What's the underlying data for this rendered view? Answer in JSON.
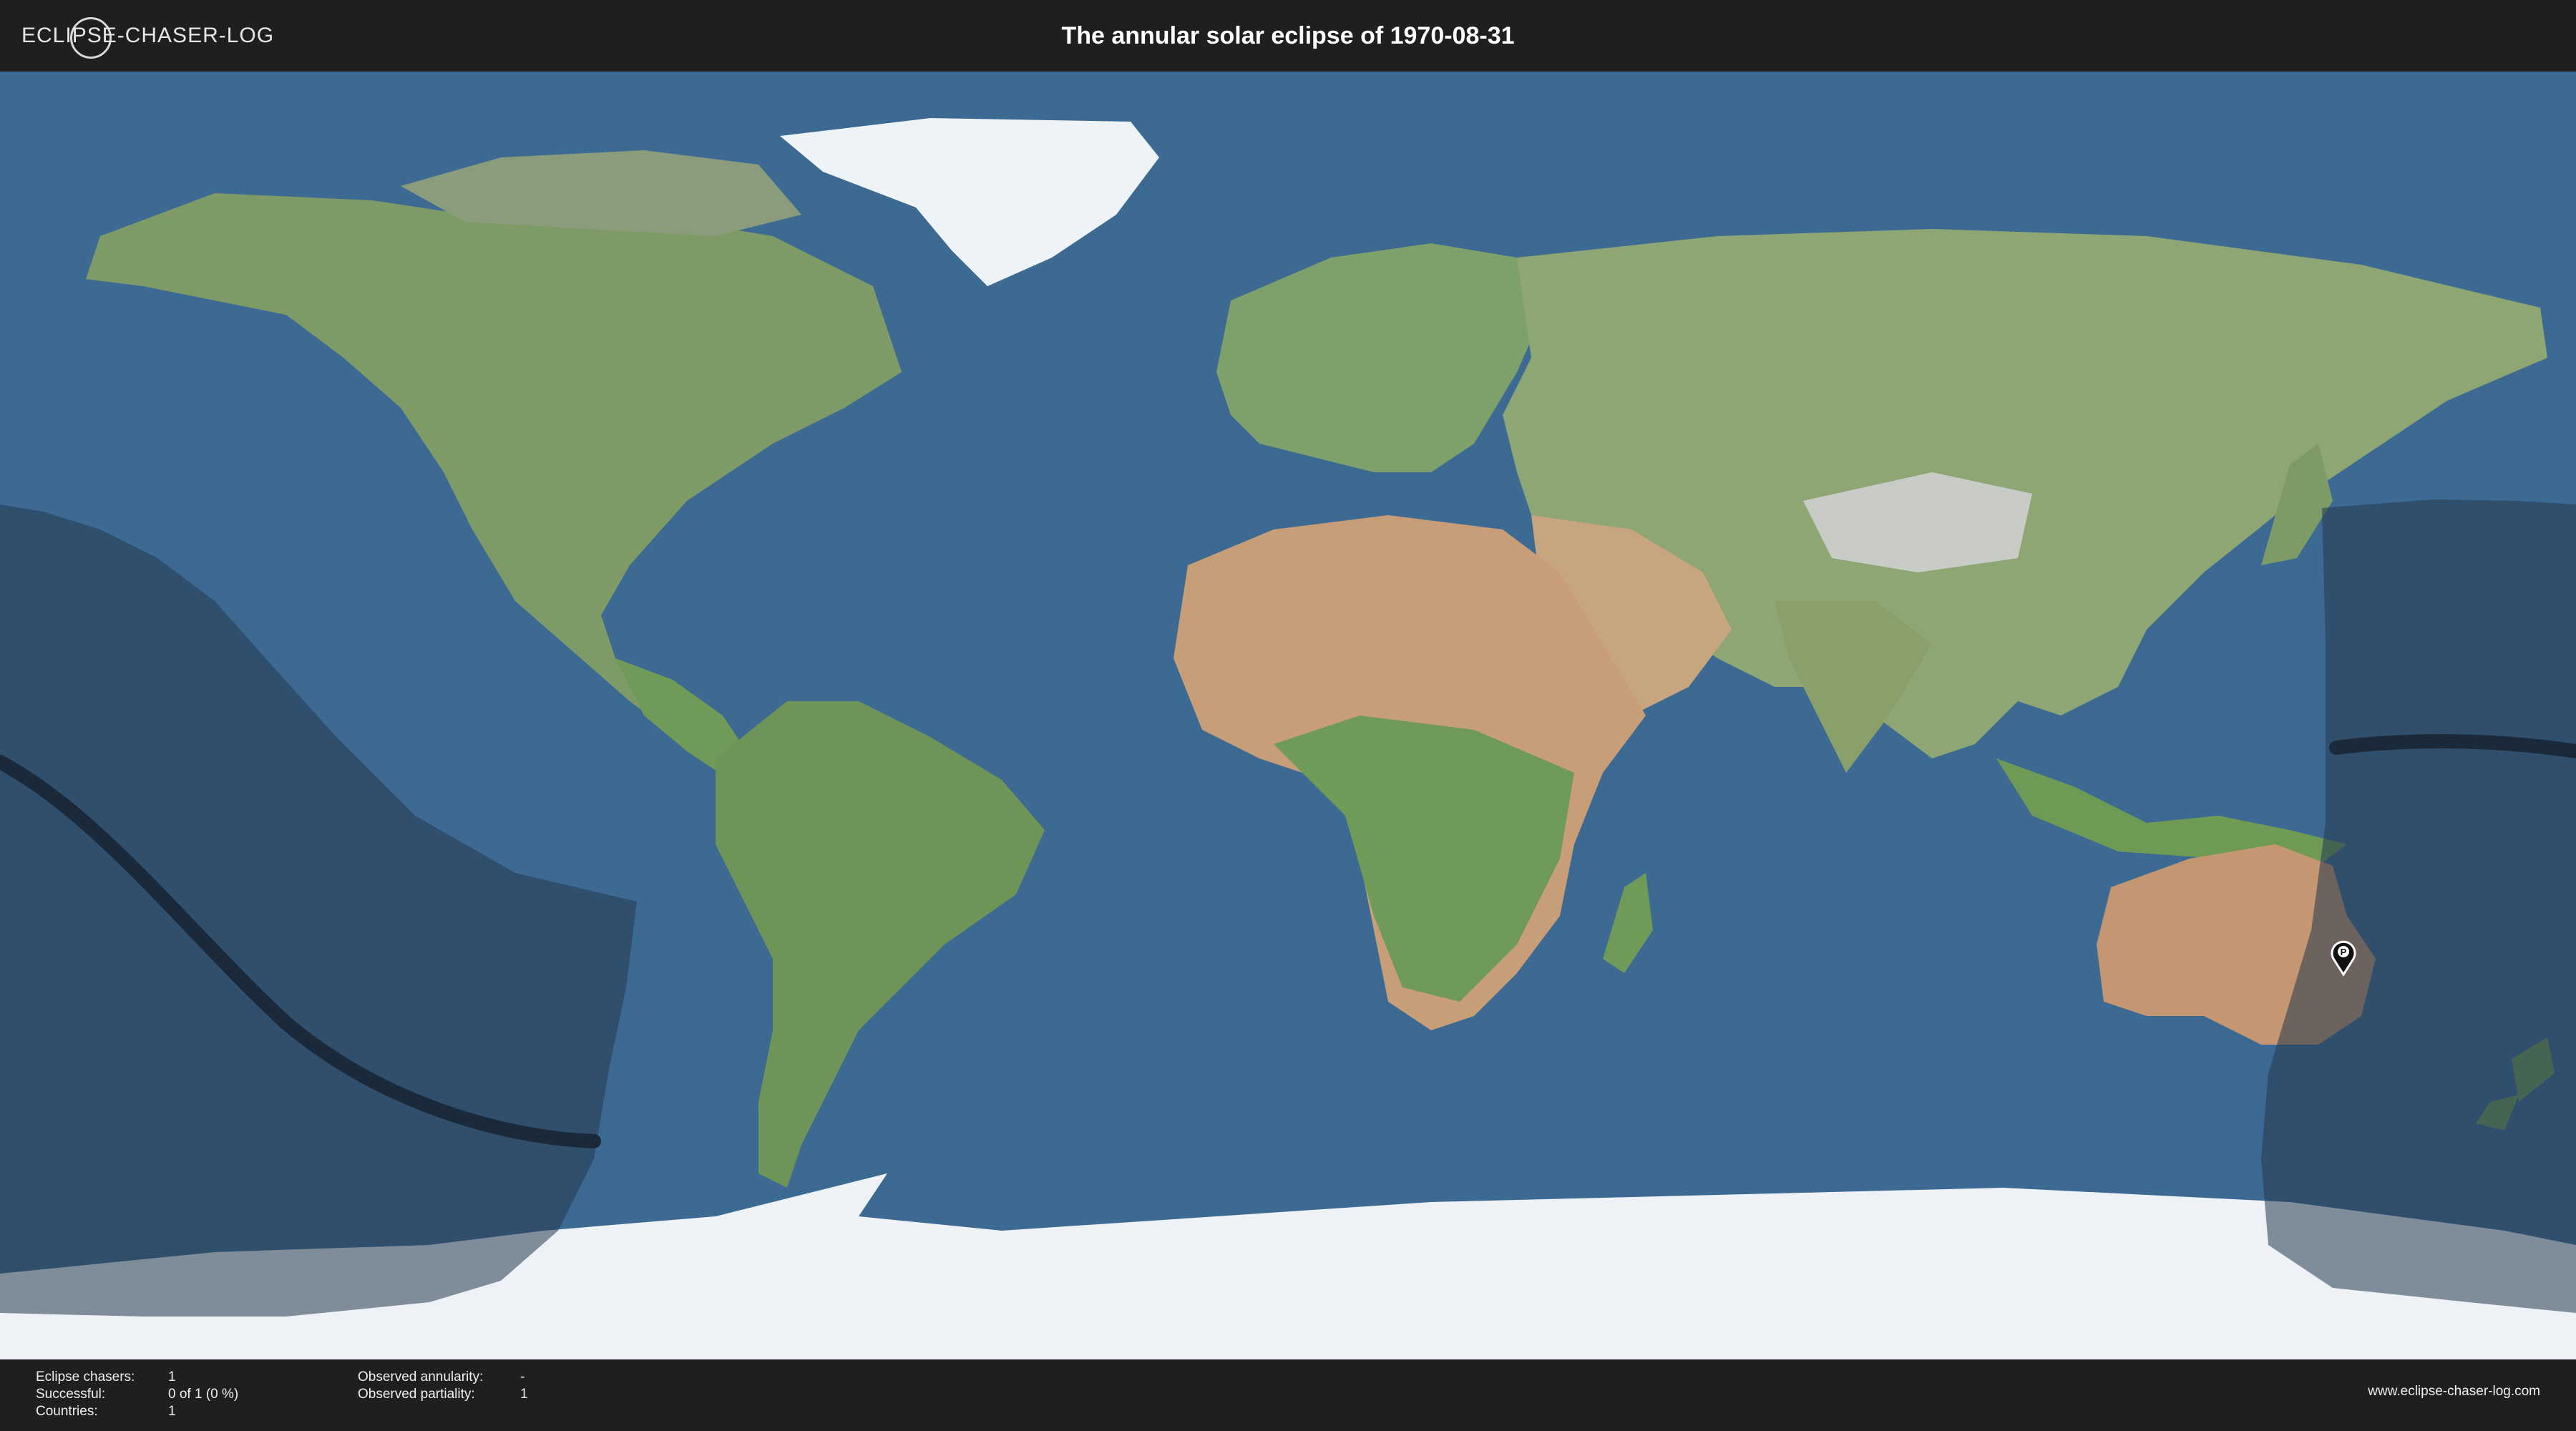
{
  "header": {
    "logo_text": "ECLIPSE-CHASER-LOG",
    "title": "The annular solar eclipse of 1970-08-31"
  },
  "map": {
    "ocean_color": "#3d6a92",
    "eclipse_zone_color": "#24384f",
    "central_line_color": "#1b2a3b",
    "marker": {
      "label": "P",
      "icon": "map-pin-icon"
    }
  },
  "footer": {
    "stats_left": [
      {
        "label": "Eclipse chasers:",
        "value": "1"
      },
      {
        "label": "Successful:",
        "value": "0 of 1 (0 %)"
      },
      {
        "label": "Countries:",
        "value": "1"
      }
    ],
    "stats_right": [
      {
        "label": "Observed annularity:",
        "value": "-"
      },
      {
        "label": "Observed partiality:",
        "value": "1"
      }
    ],
    "website": "www.eclipse-chaser-log.com"
  }
}
